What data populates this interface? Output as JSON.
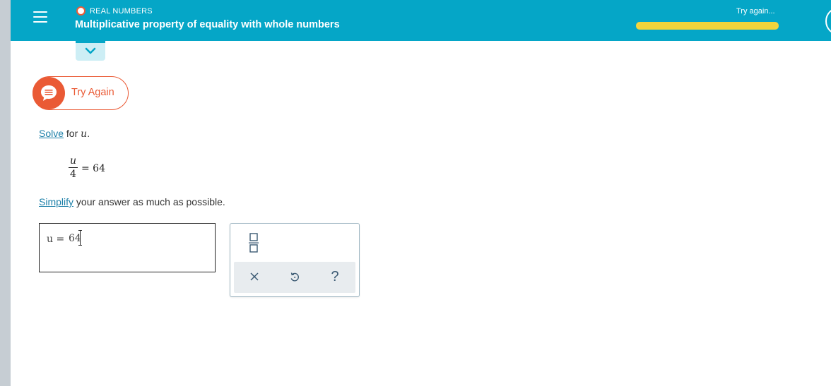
{
  "header": {
    "topic": "REAL NUMBERS",
    "title": "Multiplicative property of equality with whole numbers",
    "status": "Try again...",
    "progress": {
      "segments_total": 5,
      "segments_complete": 5
    },
    "colors": {
      "bar": "#05a6c7",
      "topic_dot": "#ea5a35",
      "progress": "#f2d43a"
    }
  },
  "feedback": {
    "label": "Try Again",
    "color": "#ea5a35"
  },
  "question": {
    "line1_link": "Solve",
    "line1_rest": " for ",
    "line1_var": "u",
    "line1_end": ".",
    "equation": {
      "numerator": "u",
      "denominator": "4",
      "rhs": "= 64"
    },
    "line2_link": "Simplify",
    "line2_rest": " your answer as much as possible."
  },
  "answer": {
    "lhs": "u =",
    "value": "64"
  },
  "tools": {
    "fraction": "fraction-template-icon",
    "clear": "clear-icon",
    "undo": "undo-icon",
    "help": "?"
  }
}
